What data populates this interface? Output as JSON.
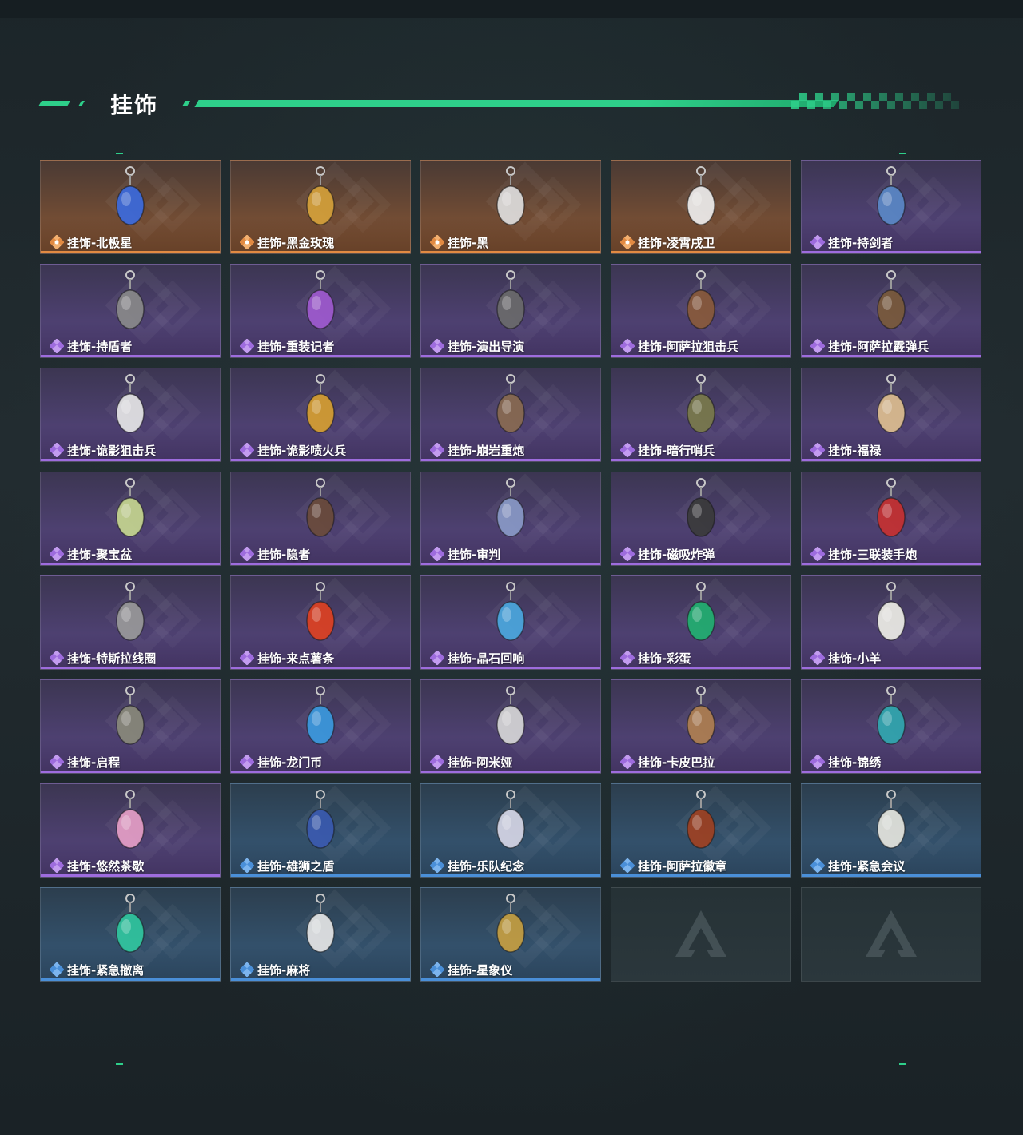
{
  "section": {
    "title": "挂饰"
  },
  "colors": {
    "accent": "#2ecf8a",
    "orange": "#e28a42",
    "purple": "#9e6cde",
    "blue": "#4a8fd8"
  },
  "items": [
    {
      "name": "挂饰-北极星",
      "rarity": "orange",
      "icon": "blue-star-charm",
      "hue": "#3a6ae0"
    },
    {
      "name": "挂饰-黑金玫瑰",
      "rarity": "orange",
      "icon": "black-gold-rose-charm",
      "hue": "#d6a23a"
    },
    {
      "name": "挂饰-黑",
      "rarity": "orange",
      "icon": "black-tag-charm",
      "hue": "#e0e0e0"
    },
    {
      "name": "挂饰-凌霄戌卫",
      "rarity": "orange",
      "icon": "guard-dog-charm",
      "hue": "#f0f0f0"
    },
    {
      "name": "挂饰-持剑者",
      "rarity": "purple",
      "icon": "sword-bearer-charm",
      "hue": "#5a88c8"
    },
    {
      "name": "挂饰-持盾者",
      "rarity": "purple",
      "icon": "shield-bearer-charm",
      "hue": "#8a8a8a"
    },
    {
      "name": "挂饰-重装记者",
      "rarity": "purple",
      "icon": "armored-reporter-charm",
      "hue": "#a05ad0"
    },
    {
      "name": "挂饰-演出导演",
      "rarity": "purple",
      "icon": "show-director-charm",
      "hue": "#6a6a6a"
    },
    {
      "name": "挂饰-阿萨拉狙击兵",
      "rarity": "purple",
      "icon": "asala-sniper-charm",
      "hue": "#8a5a3a"
    },
    {
      "name": "挂饰-阿萨拉霰弹兵",
      "rarity": "purple",
      "icon": "asala-shotgunner-charm",
      "hue": "#7a5a3a"
    },
    {
      "name": "挂饰-诡影狙击兵",
      "rarity": "purple",
      "icon": "ghost-sniper-charm",
      "hue": "#e8e8e8"
    },
    {
      "name": "挂饰-诡影喷火兵",
      "rarity": "purple",
      "icon": "ghost-flamer-charm",
      "hue": "#d8a030"
    },
    {
      "name": "挂饰-崩岩重炮",
      "rarity": "purple",
      "icon": "rock-cannon-charm",
      "hue": "#8a6a50"
    },
    {
      "name": "挂饰-暗行哨兵",
      "rarity": "purple",
      "icon": "shadow-sentry-charm",
      "hue": "#7a7a4a"
    },
    {
      "name": "挂饰-福禄",
      "rarity": "purple",
      "icon": "gourd-charm",
      "hue": "#e0c090"
    },
    {
      "name": "挂饰-聚宝盆",
      "rarity": "purple",
      "icon": "treasure-bowl-charm",
      "hue": "#c8d890"
    },
    {
      "name": "挂饰-隐者",
      "rarity": "purple",
      "icon": "hermit-card-charm",
      "hue": "#6a4a3a"
    },
    {
      "name": "挂饰-审判",
      "rarity": "purple",
      "icon": "judgement-card-charm",
      "hue": "#8a9ac8"
    },
    {
      "name": "挂饰-磁吸炸弹",
      "rarity": "purple",
      "icon": "magnet-bomb-charm",
      "hue": "#3a3a3a"
    },
    {
      "name": "挂饰-三联装手炮",
      "rarity": "purple",
      "icon": "triple-hand-cannon-charm",
      "hue": "#c83030"
    },
    {
      "name": "挂饰-特斯拉线圈",
      "rarity": "purple",
      "icon": "tesla-coil-charm",
      "hue": "#9a9a9a"
    },
    {
      "name": "挂饰-来点薯条",
      "rarity": "purple",
      "icon": "fries-charm",
      "hue": "#e04020"
    },
    {
      "name": "挂饰-晶石回响",
      "rarity": "purple",
      "icon": "crystal-echo-charm",
      "hue": "#4aa8e0"
    },
    {
      "name": "挂饰-彩蛋",
      "rarity": "purple",
      "icon": "easter-egg-charm",
      "hue": "#20b070"
    },
    {
      "name": "挂饰-小羊",
      "rarity": "purple",
      "icon": "lamb-charm",
      "hue": "#f0f0e8"
    },
    {
      "name": "挂饰-启程",
      "rarity": "purple",
      "icon": "departure-medal-charm",
      "hue": "#8a8a7a"
    },
    {
      "name": "挂饰-龙门币",
      "rarity": "purple",
      "icon": "lungmen-coin-charm",
      "hue": "#3a9ae0"
    },
    {
      "name": "挂饰-阿米娅",
      "rarity": "purple",
      "icon": "amiya-charm",
      "hue": "#d8d8d8"
    },
    {
      "name": "挂饰-卡皮巴拉",
      "rarity": "purple",
      "icon": "capybara-charm",
      "hue": "#b08050"
    },
    {
      "name": "挂饰-锦绣",
      "rarity": "purple",
      "icon": "butterfly-charm",
      "hue": "#30a8b0"
    },
    {
      "name": "挂饰-悠然茶歇",
      "rarity": "purple",
      "icon": "cupcake-charm",
      "hue": "#e8a0c8"
    },
    {
      "name": "挂饰-雄狮之盾",
      "rarity": "blue",
      "icon": "lion-shield-charm",
      "hue": "#3a5ab0"
    },
    {
      "name": "挂饰-乐队纪念",
      "rarity": "blue",
      "icon": "band-badge-charm",
      "hue": "#d8d8e8"
    },
    {
      "name": "挂饰-阿萨拉徽章",
      "rarity": "blue",
      "icon": "asala-badge-charm",
      "hue": "#a04020"
    },
    {
      "name": "挂饰-紧急会议",
      "rarity": "blue",
      "icon": "emergency-meeting-charm",
      "hue": "#e8e8e0"
    },
    {
      "name": "挂饰-紧急撤离",
      "rarity": "blue",
      "icon": "emergency-exit-charm",
      "hue": "#30c8a0"
    },
    {
      "name": "挂饰-麻将",
      "rarity": "blue",
      "icon": "mahjong-tile-charm",
      "hue": "#e8e8e8"
    },
    {
      "name": "挂饰-星象仪",
      "rarity": "blue",
      "icon": "astrolabe-charm",
      "hue": "#c8a040"
    },
    {
      "name": "",
      "rarity": "empty",
      "icon": "empty-slot-logo-icon",
      "hue": ""
    },
    {
      "name": "",
      "rarity": "empty",
      "icon": "empty-slot-logo-icon",
      "hue": ""
    }
  ]
}
